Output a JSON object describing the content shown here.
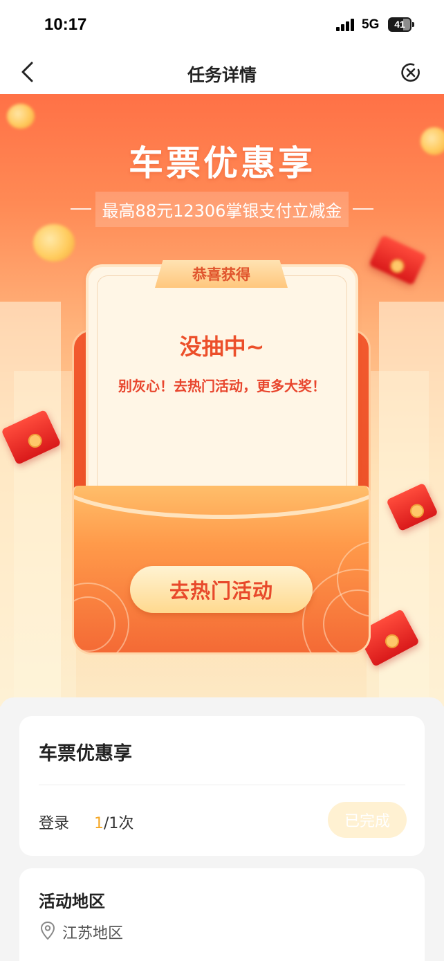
{
  "status_bar": {
    "time": "10:17",
    "network": "5G",
    "battery": "41"
  },
  "nav": {
    "title": "任务详情",
    "back_icon": "chevron-left-icon",
    "close_icon": "close-circle-icon"
  },
  "banner": {
    "title": "车票优惠享",
    "subtitle": "最高88元12306掌银支付立减金"
  },
  "result_card": {
    "ribbon": "恭喜获得",
    "title": "没抽中~",
    "message": "别灰心！去热门活动，更多大奖！",
    "button_label": "去热门活动"
  },
  "task": {
    "title": "车票优惠享",
    "action_label": "登录",
    "progress_done": "1",
    "progress_total": "/1次",
    "status_label": "已完成"
  },
  "region": {
    "title": "活动地区",
    "icon": "location-pin-icon",
    "value": "江苏地区"
  },
  "colors": {
    "accent": "#ec4f2a",
    "banner_top": "#ff7146",
    "progress_highlight": "#f5a623"
  }
}
